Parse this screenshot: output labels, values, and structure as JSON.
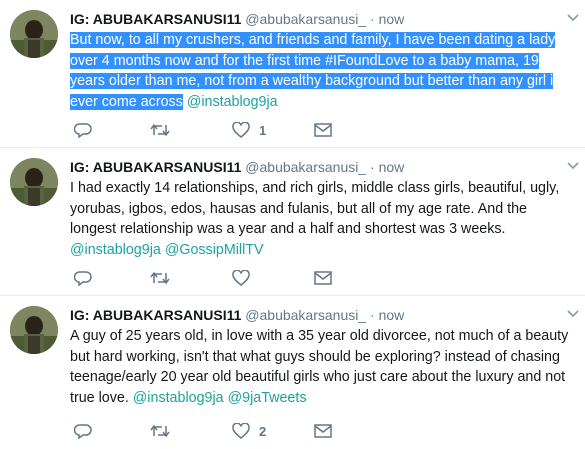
{
  "tweets": [
    {
      "name": "IG: ABUBAKARSANUSI11",
      "handle": "@abubakarsanusi_",
      "separator": "·",
      "time": "now",
      "text_selected": "But now, to all my crushers, and friends and family, I have been dating a lady over 4 months now and for the first time #IFoundLove to a baby mama, 19 years older than me, not from a wealthy background but better than any girl i ever come across",
      "text_plain": "",
      "mentions": [
        "@instablog9ja"
      ],
      "likes": "1",
      "retweets": ""
    },
    {
      "name": "IG: ABUBAKARSANUSI11",
      "handle": "@abubakarsanusi_",
      "separator": "·",
      "time": "now",
      "text_selected": "",
      "text_plain": "I had exactly 14 relationships, and rich girls, middle class girls, beautiful, ugly, yorubas, igbos, edos, hausas and fulanis, but all of my age rate. And the longest relationship was a year and a half and shortest was 3 weeks.",
      "mentions": [
        "@instablog9ja",
        "@GossipMillTV"
      ],
      "likes": "",
      "retweets": ""
    },
    {
      "name": "IG: ABUBAKARSANUSI11",
      "handle": "@abubakarsanusi_",
      "separator": "·",
      "time": "now",
      "text_selected": "",
      "text_plain": "A guy of 25 years old, in love with a 35 year old divorcee, not much of a beauty but hard working, isn't that what guys should be exploring? instead of chasing teenage/early 20 year old beautiful girls who just care about the luxury and not true love.",
      "mentions": [
        "@instablog9ja",
        "@9jaTweets"
      ],
      "likes": "2",
      "retweets": ""
    }
  ],
  "icons": {
    "reply": "reply-icon",
    "retweet": "retweet-icon",
    "like": "heart-icon",
    "message": "envelope-icon",
    "more": "chevron-down-icon"
  },
  "colors": {
    "selection": "#3390ff",
    "mention": "#1da1a1",
    "muted": "#657786",
    "divider": "#e6ecf0"
  }
}
